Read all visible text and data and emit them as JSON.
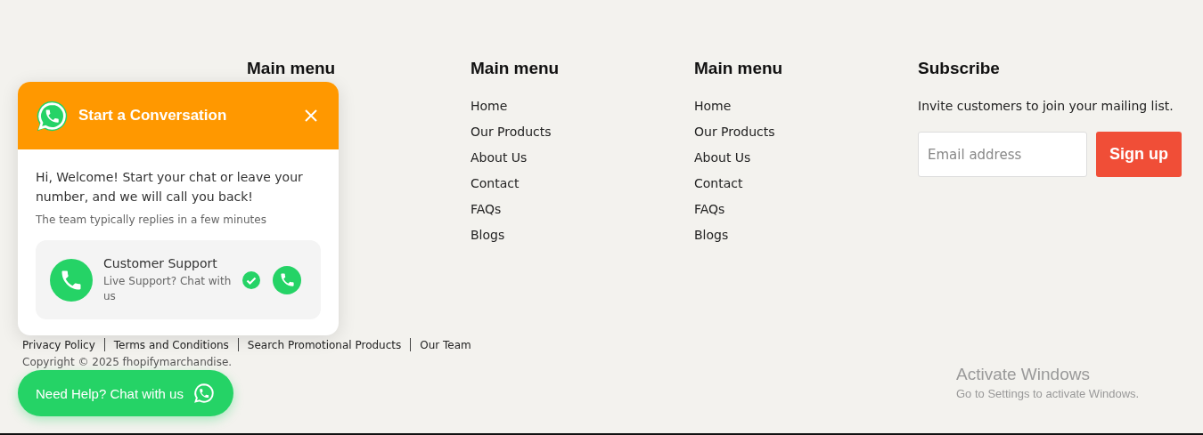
{
  "footer": {
    "columns": [
      {
        "heading": "Main menu"
      },
      {
        "heading": "Main menu",
        "links": [
          "Home",
          "Our Products",
          "About Us",
          "Contact",
          "FAQs",
          "Blogs"
        ]
      },
      {
        "heading": "Main menu",
        "links": [
          "Home",
          "Our Products",
          "About Us",
          "Contact",
          "FAQs",
          "Blogs"
        ]
      }
    ],
    "subscribe": {
      "heading": "Subscribe",
      "text": "Invite customers to join your mailing list.",
      "email": {
        "placeholder": "Email address"
      },
      "button": "Sign up"
    }
  },
  "legal_links": [
    "Privacy Policy",
    "Terms and Conditions",
    "Search Promotional Products",
    "Our Team"
  ],
  "copyright": "Copyright © 2025 fhopifymarchandise.",
  "chat_popup": {
    "title": "Start a Conversation",
    "message": "Hi, Welcome! Start your chat or leave your number, and we will call you back!",
    "note": "The team typically replies in a few minutes",
    "agent": {
      "name": "Customer Support",
      "status": "Live Support? Chat with us",
      "online": true
    }
  },
  "chat_button": {
    "label": "Need Help? Chat with us"
  },
  "os_notice": {
    "title": "Activate Windows",
    "text": "Go to Settings to activate Windows."
  }
}
